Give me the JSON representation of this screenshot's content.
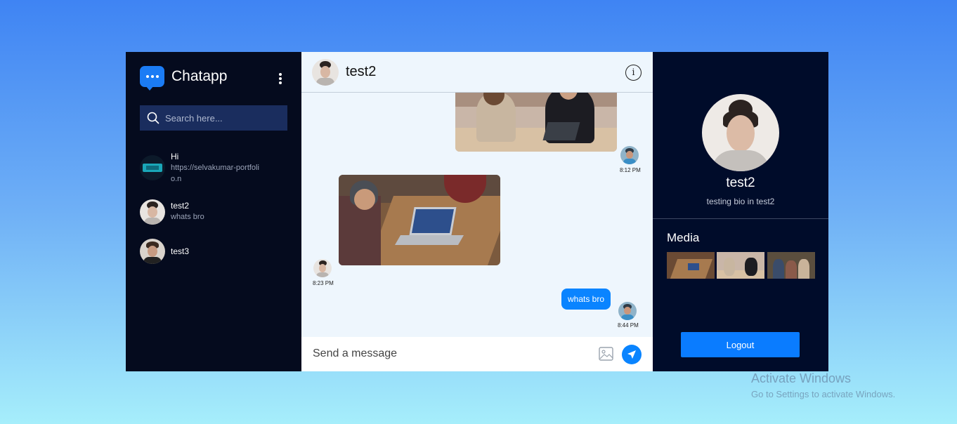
{
  "brand": {
    "name": "Chatapp",
    "icon": "chat-bubble-icon",
    "accent": "#1b7cf5"
  },
  "sidebar": {
    "search_placeholder": "Search here...",
    "contacts": [
      {
        "name": "Hi",
        "last_message": "https://selvakumar-portfolio.n"
      },
      {
        "name": "test2",
        "last_message": "whats bro"
      },
      {
        "name": "test3",
        "last_message": ""
      }
    ]
  },
  "chat": {
    "title": "test2",
    "messages": [
      {
        "type": "image",
        "from": "me",
        "time": "8:12 PM"
      },
      {
        "type": "image",
        "from": "test2",
        "time": "8:23 PM"
      },
      {
        "type": "text",
        "from": "me",
        "text": "whats bro",
        "time": "8:44 PM"
      }
    ],
    "composer_placeholder": "Send a message"
  },
  "profile": {
    "name": "test2",
    "bio": "testing bio in test2",
    "media_title": "Media",
    "media_count": 3,
    "logout_label": "Logout"
  },
  "watermark": {
    "line1": "Activate Windows",
    "line2": "Go to Settings to activate Windows."
  },
  "colors": {
    "sidebar_bg": "#050b1e",
    "chat_bg": "#eef6fd",
    "profile_bg": "#000c2a",
    "bubble": "#0a84ff"
  }
}
